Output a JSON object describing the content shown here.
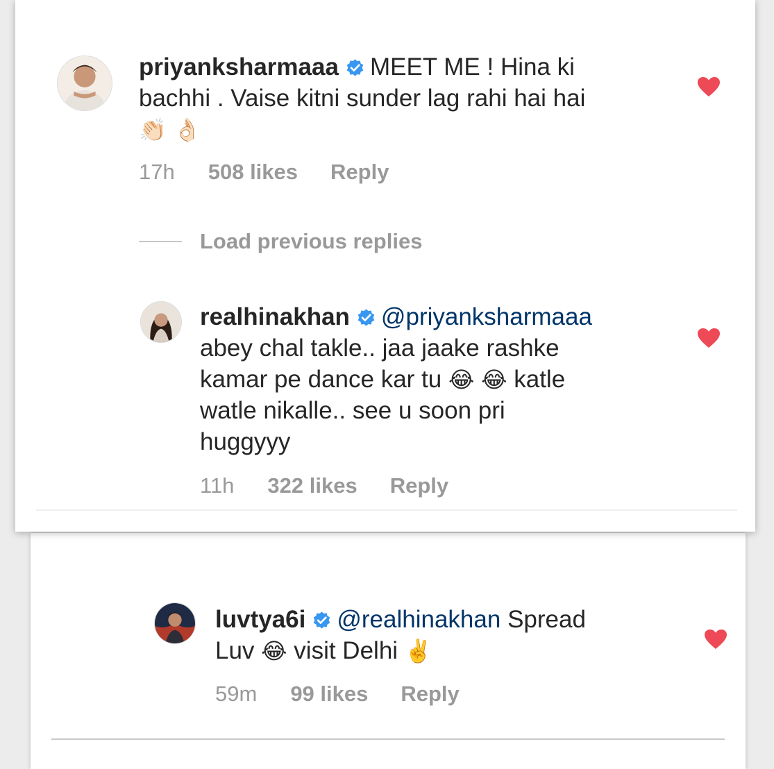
{
  "comments": [
    {
      "username": "priyanksharmaaa",
      "verified": true,
      "text_lines": [
        "MEET ME ! Hina ki",
        "bachhi . Vaise kitni sunder lag rahi hai hai"
      ],
      "emoji_line": [
        "👏🏻",
        "👌🏻"
      ],
      "time": "17h",
      "likes": "508 likes",
      "reply": "Reply",
      "liked": true
    },
    {
      "username": "realhinakhan",
      "verified": true,
      "mention": "@priyanksharmaaa",
      "text_lines": [
        "abey chal takle.. jaa jaake rashke",
        "kamar pe dance kar tu",
        "katle",
        "watle nikalle.. see u soon pri",
        "huggyyy"
      ],
      "emojis": [
        "😂",
        "😂"
      ],
      "time": "11h",
      "likes": "322 likes",
      "reply": "Reply",
      "liked": true
    },
    {
      "username": "luvtya6i",
      "verified": true,
      "mention": "@realhinakhan",
      "text_after_mention": "Spread",
      "line2_start": "Luv",
      "line2_end": "visit Delhi",
      "emojis": [
        "😂",
        "✌️"
      ],
      "time": "59m",
      "likes": "99 likes",
      "reply": "Reply",
      "liked": true
    }
  ],
  "load_previous_replies": "Load previous replies",
  "colors": {
    "heart": "#ed4956",
    "verified": "#3897f0",
    "meta": "#999999",
    "mention": "#003569"
  },
  "icons": [
    "verified-badge-icon",
    "heart-icon",
    "avatar-icon"
  ]
}
